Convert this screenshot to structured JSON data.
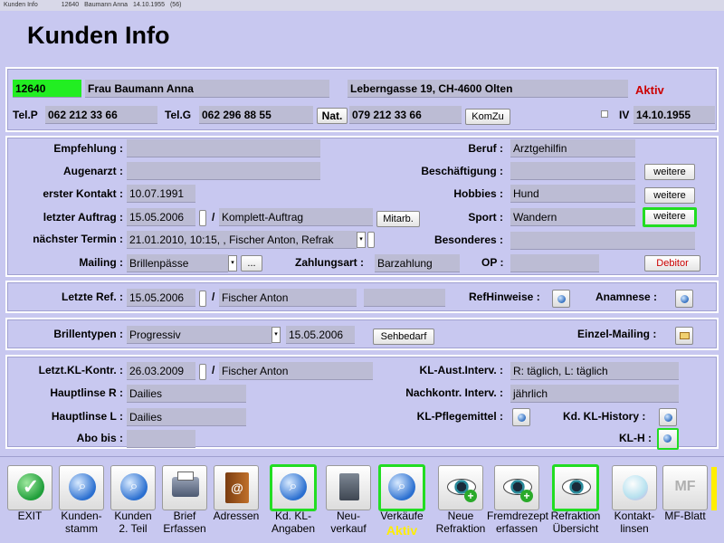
{
  "window": {
    "title": "Kunden Info",
    "id": "12640",
    "customer": "Baumann Anna",
    "birth": "14.10.1955",
    "age": "(56)"
  },
  "header": {
    "title": "Kunden Info"
  },
  "customer": {
    "number": "12640",
    "name": "Frau Baumann Anna",
    "address": "Leberngasse 19, CH-4600 Olten",
    "status": "Aktiv",
    "telp_label": "Tel.P",
    "telp": "062 212 33 66",
    "telg_label": "Tel.G",
    "telg": "062 296 88 55",
    "nat_label": "Nat.",
    "nat": "079 212 33 66",
    "komzu": "KomZu",
    "iv_label": "IV",
    "iv": "14.10.1955"
  },
  "details": {
    "empfehlung_label": "Empfehlung :",
    "augenarzt_label": "Augenarzt :",
    "erster_kontakt_label": "erster Kontakt :",
    "erster_kontakt": "10.07.1991",
    "letzter_auftrag_label": "letzter Auftrag :",
    "letzter_auftrag": "15.05.2006",
    "auftrag_sep": "/",
    "auftrag_typ": "Komplett-Auftrag",
    "mitarb": "Mitarb.",
    "naechster_termin_label": "nächster Termin :",
    "naechster_termin": "21.01.2010, 10:15, , Fischer Anton, Refrak",
    "mailing_label": "Mailing :",
    "mailing": "Brillenpässe",
    "mailing_more": "...",
    "zahlungsart_label": "Zahlungsart :",
    "zahlungsart": "Barzahlung",
    "op_label": "OP :",
    "beruf_label": "Beruf :",
    "beruf": "Arztgehilfin",
    "beschaeftigung_label": "Beschäftigung :",
    "hobbies_label": "Hobbies :",
    "hobbies": "Hund",
    "sport_label": "Sport :",
    "sport": "Wandern",
    "besonderes_label": "Besonderes :",
    "weitere": "weitere",
    "debitor": "Debitor"
  },
  "refraction": {
    "letzte_ref_label": "Letzte Ref. :",
    "letzte_ref": "15.05.2006",
    "sep": "/",
    "optician": "Fischer Anton",
    "refhinweise_label": "RefHinweise :",
    "anamnese_label": "Anamnese :"
  },
  "glasses": {
    "brillentypen_label": "Brillentypen :",
    "brillentypen": "Progressiv",
    "date": "15.05.2006",
    "sehbedarf": "Sehbedarf",
    "einzel_mailing_label": "Einzel-Mailing :"
  },
  "contacts": {
    "letzt_kl_label": "Letzt.KL-Kontr. :",
    "letzt_kl": "26.03.2009",
    "sep": "/",
    "optician": "Fischer Anton",
    "hauptlinse_r_label": "Hauptlinse R :",
    "hauptlinse_r": "Dailies",
    "hauptlinse_l_label": "Hauptlinse L :",
    "hauptlinse_l": "Dailies",
    "abo_label": "Abo bis :",
    "kl_aust_label": "KL-Aust.Interv. :",
    "kl_aust": "R: täglich, L: täglich",
    "nachkontr_label": "Nachkontr. Interv. :",
    "nachkontr": "jährlich",
    "kl_pflege_label": "KL-Pflegemittel :",
    "kd_kl_history_label": "Kd. KL-History :",
    "kl_h_label": "KL-H :"
  },
  "toolbar": {
    "exit": "EXIT",
    "kundenstamm_1": "Kunden-",
    "kundenstamm_2": "stamm",
    "kunden2_1": "Kunden",
    "kunden2_2": "2. Teil",
    "brief_1": "Brief",
    "brief_2": "Erfassen",
    "adressen": "Adressen",
    "kdkl_1": "Kd. KL-",
    "kdkl_2": "Angaben",
    "neuverkauf_1": "Neu-",
    "neuverkauf_2": "verkauf",
    "verkaeufe": "Verkäufe",
    "verkaeufe_status": "Aktiv",
    "neue_ref_1": "Neue",
    "neue_ref_2": "Refraktion",
    "fremdrezept_1": "Fremdrezept",
    "fremdrezept_2": "erfassen",
    "ref_uebersicht_1": "Refraktion",
    "ref_uebersicht_2": "Übersicht",
    "kontaktlinsen_1": "Kontakt-",
    "kontaktlinsen_2": "linsen",
    "mf_icon": "MF",
    "mf_blatt": "MF-Blatt"
  },
  "colors": {
    "background": "#c8c8f0",
    "field": "#bcbcd4",
    "highlight_green": "#22dd22",
    "customer_id_bg": "#22ee22",
    "status_red": "#cc0000",
    "debitor_red": "#cc0000",
    "verkaeufe_status": "#ffee00"
  }
}
